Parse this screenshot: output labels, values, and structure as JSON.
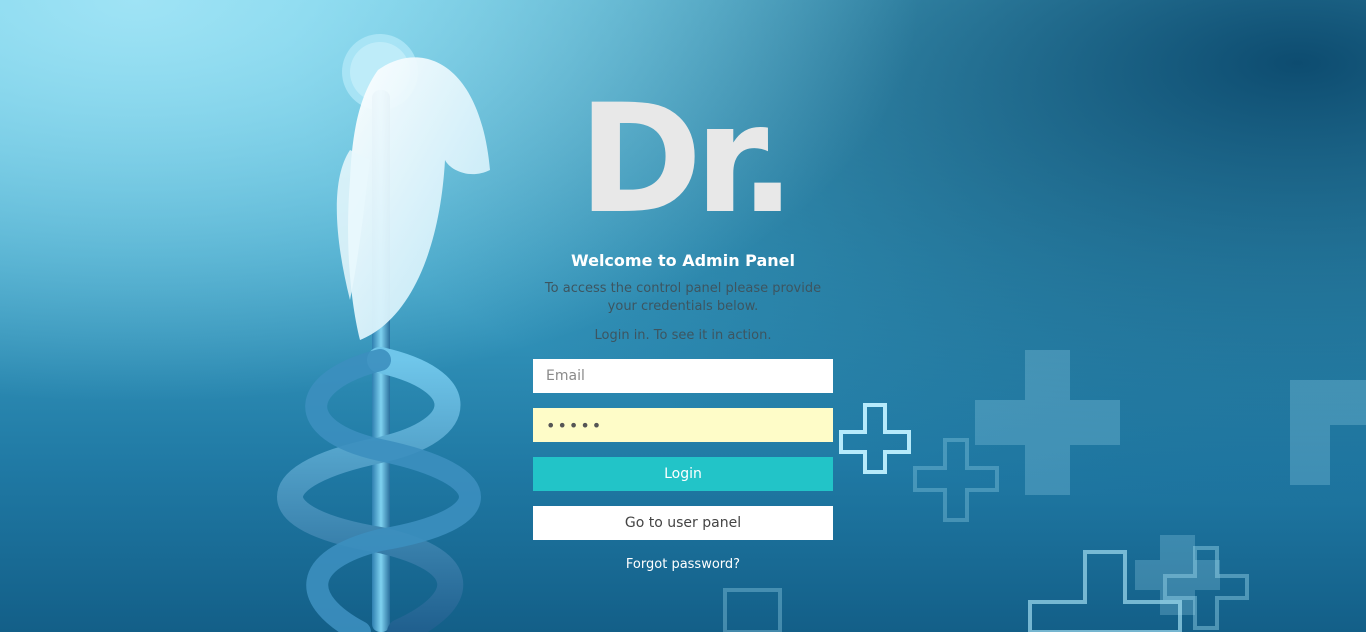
{
  "brand": {
    "logo_text": "Dr."
  },
  "login": {
    "welcome_title": "Welcome to Admin Panel",
    "description": "To access the control panel please provide your credentials below.",
    "hint": "Login in. To see it in action.",
    "email_placeholder": "Email",
    "email_value": "",
    "password_value": "•••••",
    "login_button": "Login",
    "user_panel_button": "Go to user panel",
    "forgot_link": "Forgot password?"
  },
  "colors": {
    "login_button": "#22c4c8",
    "password_autofill_bg": "#fefcc8",
    "logo": "#e8e8e8",
    "background_dark": "#135f88",
    "background_light": "#9fe3f5"
  },
  "background": {
    "icons": [
      "caduceus-icon",
      "medical-cross-icon"
    ]
  }
}
